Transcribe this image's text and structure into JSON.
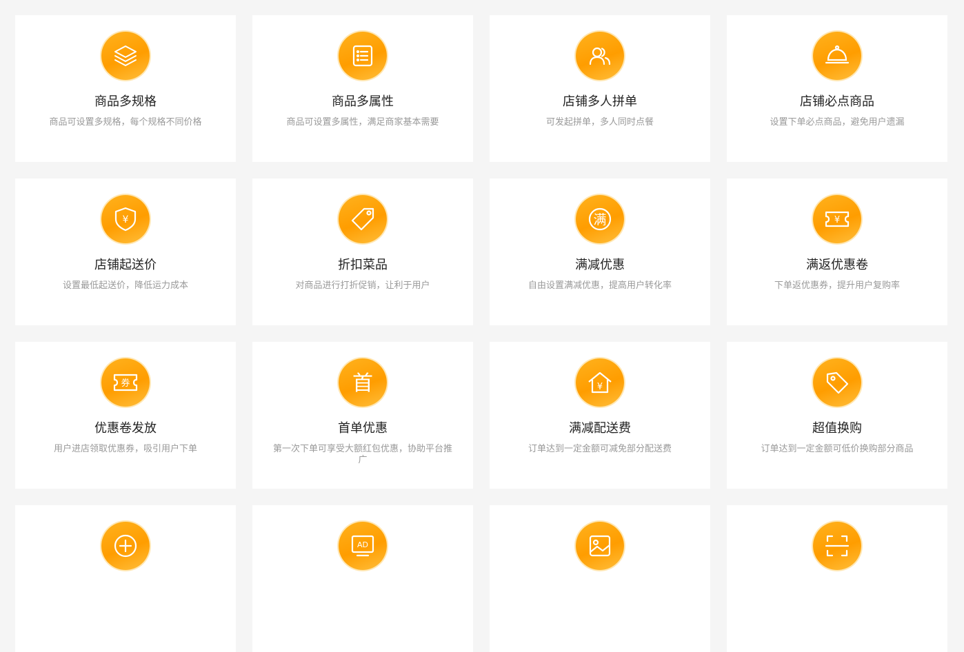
{
  "theme": {
    "accent": "#ff9d00",
    "title_color": "#222222",
    "desc_color": "#999999",
    "background": "#f5f5f5"
  },
  "features": [
    {
      "icon": "layers-icon",
      "title": "商品多规格",
      "desc": "商品可设置多规格，每个规格不同价格"
    },
    {
      "icon": "list-icon",
      "title": "商品多属性",
      "desc": "商品可设置多属性，满足商家基本需要"
    },
    {
      "icon": "users-icon",
      "title": "店铺多人拼单",
      "desc": "可发起拼单，多人同时点餐"
    },
    {
      "icon": "food-cloche-icon",
      "title": "店铺必点商品",
      "desc": "设置下单必点商品，避免用户遗漏"
    },
    {
      "icon": "yuan-shield-icon",
      "title": "店铺起送价",
      "desc": "设置最低起送价，降低运力成本"
    },
    {
      "icon": "tag-icon",
      "title": "折扣菜品",
      "desc": "对商品进行打折促销，让利于用户"
    },
    {
      "icon": "man-reduction-icon",
      "title": "满减优惠",
      "desc": "自由设置满减优惠，提高用户转化率"
    },
    {
      "icon": "yuan-ticket-icon",
      "title": "满返优惠卷",
      "desc": "下单返优惠券，提升用户复购率"
    },
    {
      "icon": "coupon-ticket-icon",
      "title": "优惠卷发放",
      "desc": "用户进店领取优惠券，吸引用户下单"
    },
    {
      "icon": "first-char-icon",
      "title": "首单优惠",
      "desc": "第一次下单可享受大额红包优惠，协助平台推广"
    },
    {
      "icon": "yuan-house-icon",
      "title": "满减配送费",
      "desc": "订单达到一定金额可减免部分配送费"
    },
    {
      "icon": "price-tag-icon",
      "title": "超值换购",
      "desc": "订单达到一定金额可低价换购部分商品"
    },
    {
      "icon": "plus-circle-icon",
      "title": "",
      "desc": ""
    },
    {
      "icon": "ad-screen-icon",
      "title": "",
      "desc": ""
    },
    {
      "icon": "image-icon",
      "title": "",
      "desc": ""
    },
    {
      "icon": "scan-icon",
      "title": "",
      "desc": ""
    }
  ],
  "icon_texts": {
    "yuan": "¥",
    "man": "满",
    "juan": "券",
    "shou": "首",
    "ad": "AD"
  }
}
